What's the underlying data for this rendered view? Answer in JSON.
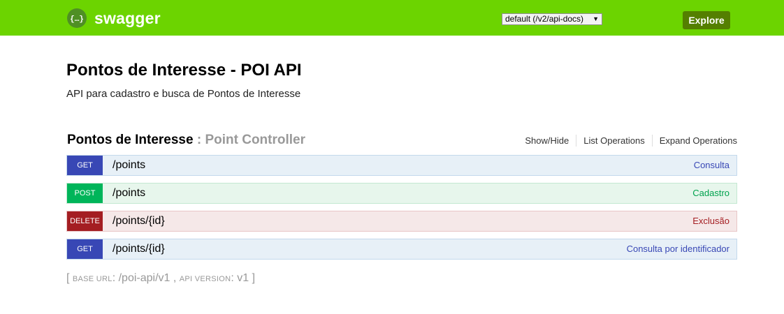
{
  "header": {
    "logo_text": "swagger",
    "logo_icon": "swagger-braces-icon",
    "spec_select": "default (/v2/api-docs)",
    "explore_label": "Explore",
    "brand_color": "#6cd400"
  },
  "info": {
    "title": "Pontos de Interesse - POI API",
    "description": "API para cadastro e busca de Pontos de Interesse"
  },
  "resource": {
    "name": "Pontos de Interesse",
    "separator": " : ",
    "controller": "Point Controller",
    "links": [
      "Show/Hide",
      "List Operations",
      "Expand Operations"
    ]
  },
  "operations": [
    {
      "method": "GET",
      "path": "/points",
      "summary": "Consulta"
    },
    {
      "method": "POST",
      "path": "/points",
      "summary": "Cadastro"
    },
    {
      "method": "DELETE",
      "path": "/points/{id}",
      "summary": "Exclusão"
    },
    {
      "method": "GET",
      "path": "/points/{id}",
      "summary": "Consulta por identificador"
    }
  ],
  "footer": {
    "open_bracket": "[ ",
    "base_url_label": "BASE URL",
    "base_url_value": "/poi-api/v1",
    "comma": " , ",
    "api_version_label": "API VERSION",
    "api_version_value": "v1",
    "close_bracket": " ]"
  }
}
